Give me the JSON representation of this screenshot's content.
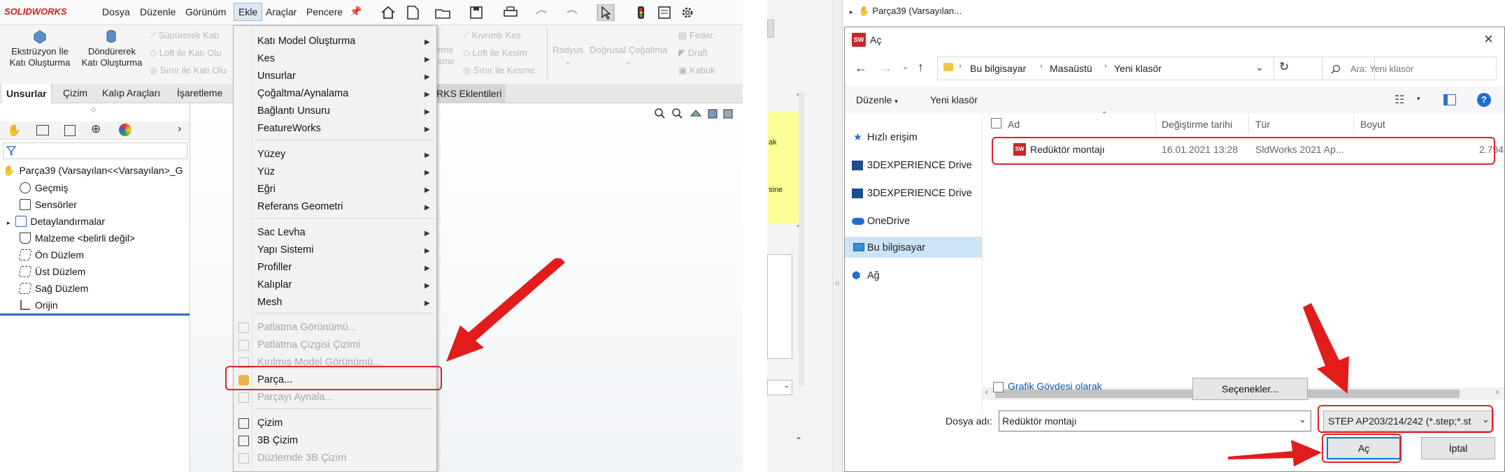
{
  "app": {
    "logo": "SOLIDWORKS",
    "menubar": [
      "Dosya",
      "Düzenle",
      "Görünüm",
      "Ekle",
      "Araçlar",
      "Pencere"
    ],
    "ribbon": {
      "extrude": [
        "Ekstrüzyon İle",
        "Katı Oluşturma"
      ],
      "revolve": [
        "Döndürerek",
        "Katı Oluşturma"
      ],
      "sweep": "Süpürerek Katı",
      "loft": "Loft ile Katı Olu",
      "boundary": "Sınır ile Katı Olu",
      "cut_partial": [
        "rme",
        "sme"
      ],
      "swept_cut": "Kıvrımlı Kes",
      "loft_cut": "Loft ile Kesim",
      "boundary_cut": "Sınır ile Kesme",
      "fillet": "Radyus",
      "pattern": "Doğrusal Çoğaltma",
      "rib": "Feder",
      "draft": "Draft",
      "shell": "Kabuk"
    },
    "tabs": [
      "Unsurlar",
      "Çizim",
      "Kalıp Araçları",
      "İşaretleme"
    ],
    "tab_partial": "RKS Eklentileri",
    "tree": {
      "root": "Parça39  (Varsayılan<<Varsayılan>_G",
      "items": [
        "Geçmiş",
        "Sensörler",
        "Detaylandırmalar",
        "Malzeme <belirli değil>",
        "Ön Düzlem",
        "Üst Düzlem",
        "Sağ Düzlem",
        "Orijin"
      ]
    }
  },
  "menu": {
    "items": [
      {
        "label": "Katı Model Oluşturma",
        "sub": true
      },
      {
        "label": "Kes",
        "sub": true
      },
      {
        "label": "Unsurlar",
        "sub": true
      },
      {
        "label": "Çoğaltma/Aynalama",
        "sub": true
      },
      {
        "label": "Bağlantı Unsuru",
        "sub": true
      },
      {
        "label": "FeatureWorks",
        "sub": true
      },
      {
        "label": "Yüzey",
        "sub": true
      },
      {
        "label": "Yüz",
        "sub": true
      },
      {
        "label": "Eğri",
        "sub": true
      },
      {
        "label": "Referans Geometri",
        "sub": true
      },
      {
        "label": "Sac Levha",
        "sub": true
      },
      {
        "label": "Yapı Sistemi",
        "sub": true
      },
      {
        "label": "Profiller",
        "sub": true
      },
      {
        "label": "Kalıplar",
        "sub": true
      },
      {
        "label": "Mesh",
        "sub": true
      },
      {
        "label": "Patlatma Görünümü...",
        "disabled": true
      },
      {
        "label": "Patlatma Çizgisi Çizimi",
        "disabled": true
      },
      {
        "label": "Kırılmış Model Görünümü...",
        "disabled": true
      },
      {
        "label": "Parça..."
      },
      {
        "label": "Parçayı Aynala...",
        "disabled": true
      },
      {
        "label": "Çizim"
      },
      {
        "label": "3B Çizim"
      },
      {
        "label": "Düzlemde 3B Çizim",
        "disabled": true
      }
    ]
  },
  "right_bg": {
    "tree_root": "Parça39  (Varsayılan...",
    "yellow_texts": [
      "ak",
      "sine"
    ]
  },
  "dialog": {
    "title": "Aç",
    "breadcrumb": [
      "Bu bilgisayar",
      "Masaüstü",
      "Yeni klasör"
    ],
    "search_placeholder": "Ara: Yeni klasör",
    "organize": "Düzenle",
    "new_folder": "Yeni klasör",
    "nav": [
      "Hızlı erişim",
      "3DEXPERIENCE Drive",
      "3DEXPERIENCE Drive",
      "OneDrive",
      "Bu bilgisayar",
      "Ağ"
    ],
    "columns": [
      "Ad",
      "Değiştirme tarihi",
      "Tür",
      "Boyut"
    ],
    "file": {
      "name": "Redüktör montajı",
      "date": "16.01.2021 13:28",
      "type": "SldWorks 2021 Ap...",
      "size": "2.794"
    },
    "graphics_body": "Grafik Gövdesi olarak",
    "options": "Seçenekler...",
    "filename_label": "Dosya adı:",
    "filename_value": "Redüktör montajı",
    "filter": "STEP AP203/214/242 (*.step;*.st",
    "open": "Aç",
    "cancel": "İptal"
  },
  "colors": {
    "highlight": "#e2222a",
    "arrow": "#e21b1b",
    "accent": "#0063b1"
  }
}
